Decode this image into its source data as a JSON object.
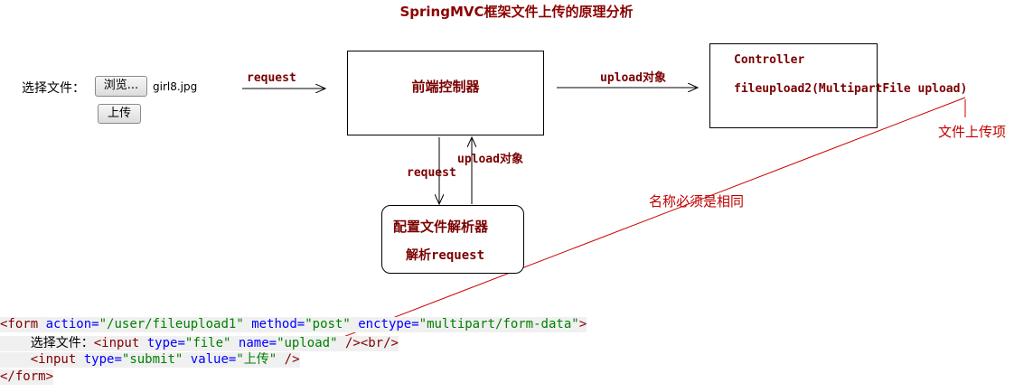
{
  "title": "SpringMVC框架文件上传的原理分析",
  "form_demo": {
    "label": "选择文件：",
    "browse_button": "浏览...",
    "file_name": "girl8.jpg",
    "upload_button": "上传"
  },
  "arrows": {
    "request_1": "request",
    "upload_obj_1": "upload对象",
    "request_2": "request",
    "upload_obj_2": "upload对象"
  },
  "boxes": {
    "front_controller": "前端控制器",
    "controller_line1": "Controller",
    "controller_line2": "fileupload2(MultipartFile upload)",
    "resolver_line1": "配置文件解析器",
    "resolver_line2_prefix": "解析",
    "resolver_line2_suffix": "request"
  },
  "annotations": {
    "file_item": "文件上传项",
    "same_name": "名称必须是相同"
  },
  "code": {
    "l1_open": "<form",
    "l1_action_attr": "action=",
    "l1_action_val": "\"/user/fileupload1\"",
    "l1_method_attr": "method=",
    "l1_method_val": "\"post\"",
    "l1_enctype_attr": "enctype=",
    "l1_enctype_val": "\"multipart/form-data\"",
    "l1_close": ">",
    "l2_text": "选择文件：",
    "l2_open": "<input",
    "l2_type_attr": "type=",
    "l2_type_val": "\"file\"",
    "l2_name_attr": "name=",
    "l2_name_val": "\"upload\"",
    "l2_close": "/><br/>",
    "l3_open": "<input",
    "l3_type_attr": "type=",
    "l3_type_val": "\"submit\"",
    "l3_value_attr": "value=",
    "l3_value_val": "\"上传\"",
    "l3_close": "/>",
    "l4": "</form>"
  },
  "colors": {
    "title": "#8b0000",
    "label": "#7a0000",
    "annotation": "#c00000",
    "connector": "#cc0000"
  }
}
